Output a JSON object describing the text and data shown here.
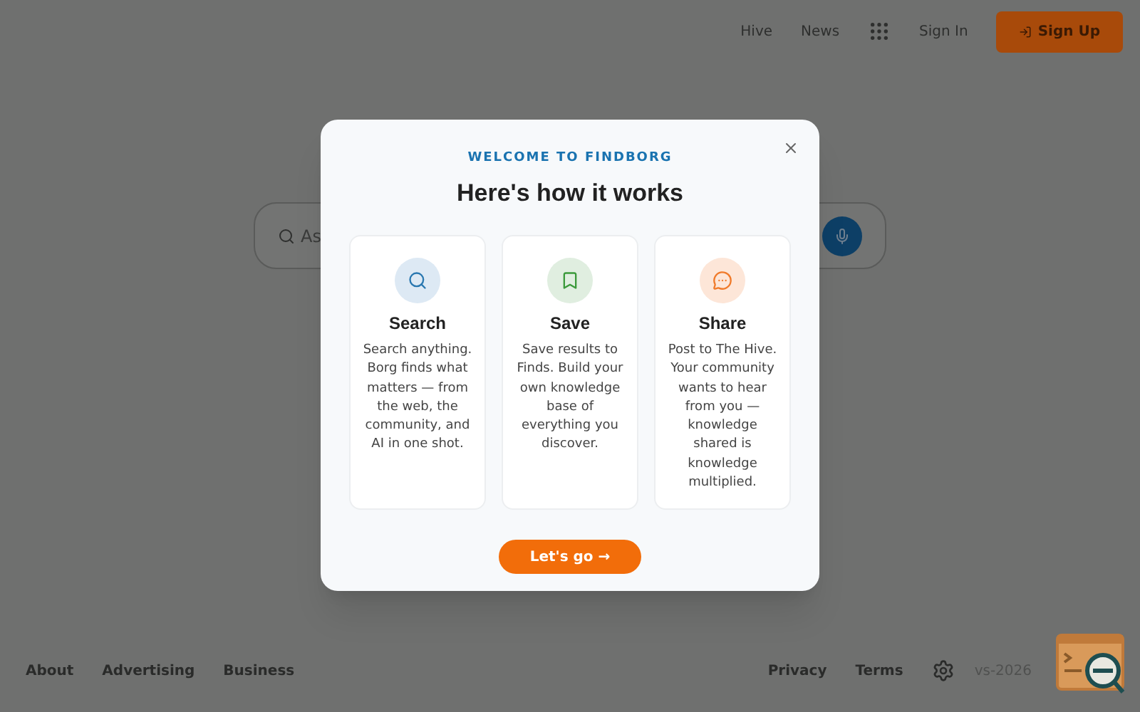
{
  "header": {
    "links": [
      "Hive",
      "News"
    ],
    "sign_in": "Sign In",
    "sign_up": "Sign Up"
  },
  "search": {
    "placeholder": "As"
  },
  "modal": {
    "eyebrow": "WELCOME TO FINDBORG",
    "title": "Here's how it works",
    "cards": [
      {
        "kind": "search",
        "title": "Search",
        "text": "Search anything. Borg finds what matters — from the web, the community, and AI in one shot."
      },
      {
        "kind": "save",
        "title": "Save",
        "text": "Save results to Finds. Build your own knowledge base of everything you discover."
      },
      {
        "kind": "share",
        "title": "Share",
        "text": "Post to The Hive. Your community wants to hear from you — knowledge shared is knowledge multiplied."
      }
    ],
    "button": "Let's go →"
  },
  "footer": {
    "left": [
      "About",
      "Advertising",
      "Business"
    ],
    "right": [
      "Privacy",
      "Terms"
    ],
    "version": "vs-2026"
  }
}
